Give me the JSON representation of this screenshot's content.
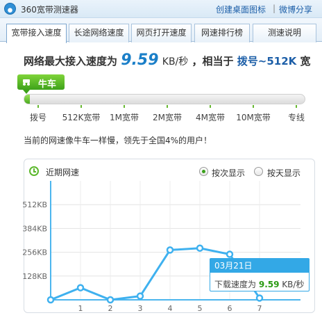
{
  "app": {
    "title": "360宽带测速器",
    "icon": "app-logo-icon"
  },
  "top_links": {
    "create_icon": "创建桌面图标",
    "separator": "|",
    "weibo_share": "微博分享"
  },
  "tabs": [
    {
      "label": "宽带接入速度",
      "active": true
    },
    {
      "label": "长途网络速度",
      "active": false
    },
    {
      "label": "网页打开速度",
      "active": false
    },
    {
      "label": "网速排行榜",
      "active": false
    },
    {
      "label": "测速说明",
      "active": false
    }
  ],
  "headline": {
    "prefix": "网络最大接入速度为",
    "speed": "9.59",
    "unit": "KB/秒",
    "middle": "，相当于",
    "level": "拨号~512K",
    "suffix": "宽"
  },
  "speed_bar": {
    "badge_label": "牛车",
    "badge_icon": "car-icon",
    "progress": 0.02,
    "levels": [
      "拨号",
      "512K宽带",
      "1M宽带",
      "2M宽带",
      "4M宽带",
      "10M宽带",
      "专线"
    ]
  },
  "comparison": "当前的网速像牛车一样慢，领先于全国4%的用户！",
  "recent": {
    "title": "近期网速",
    "icon": "clock-icon",
    "modes": [
      {
        "label": "按次显示",
        "checked": true
      },
      {
        "label": "按天显示",
        "checked": false
      }
    ]
  },
  "chart_data": {
    "type": "line",
    "x": [
      0,
      1,
      2,
      3,
      4,
      5,
      6,
      7
    ],
    "x_tick_labels": [
      "",
      "1",
      "2",
      "3",
      "4",
      "5",
      "6",
      "7"
    ],
    "series": [
      {
        "values": [
          0,
          65,
          0,
          20,
          268,
          278,
          245,
          9.59
        ]
      }
    ],
    "y_tick_labels": [
      "128KB",
      "256KB",
      "384KB",
      "512KB"
    ],
    "y_ticks": [
      128,
      256,
      384,
      512
    ],
    "ylim": [
      0,
      640
    ],
    "grid": true,
    "line_color": "#3fb1ef",
    "tooltip": {
      "date": "03月21日",
      "label": "下载速度为",
      "value": "9.59",
      "unit": "KB/秒"
    }
  },
  "colors": {
    "accent": "#1b7fc8",
    "green": "#3da21a",
    "line": "#3fb1ef",
    "link": "#1d5fa8"
  }
}
